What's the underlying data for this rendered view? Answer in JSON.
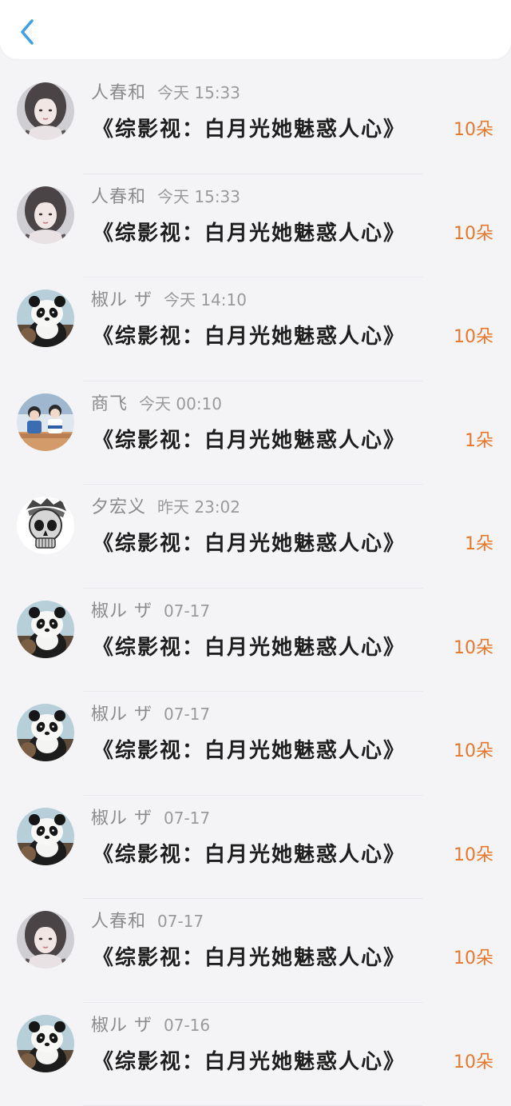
{
  "header": {
    "back_icon": "chevron-left-icon",
    "accent_color": "#3aa0e8"
  },
  "list": {
    "items": [
      {
        "name": "人春和",
        "time": "今天 15:33",
        "title": "《综影视：白月光她魅惑人心》",
        "amount": "10朵",
        "avatar": "portrait"
      },
      {
        "name": "人春和",
        "time": "今天 15:33",
        "title": "《综影视：白月光她魅惑人心》",
        "amount": "10朵",
        "avatar": "portrait"
      },
      {
        "name": "椒ル ザ",
        "time": "今天 14:10",
        "title": "《综影视：白月光她魅惑人心》",
        "amount": "10朵",
        "avatar": "panda"
      },
      {
        "name": "商飞",
        "time": "今天 00:10",
        "title": "《综影视：白月光她魅惑人心》",
        "amount": "1朵",
        "avatar": "group-photo"
      },
      {
        "name": "夕宏义",
        "time": "昨天 23:02",
        "title": "《综影视：白月光她魅惑人心》",
        "amount": "1朵",
        "avatar": "skull"
      },
      {
        "name": "椒ル ザ",
        "time": "07-17",
        "title": "《综影视：白月光她魅惑人心》",
        "amount": "10朵",
        "avatar": "panda"
      },
      {
        "name": "椒ル ザ",
        "time": "07-17",
        "title": "《综影视：白月光她魅惑人心》",
        "amount": "10朵",
        "avatar": "panda"
      },
      {
        "name": "椒ル ザ",
        "time": "07-17",
        "title": "《综影视：白月光她魅惑人心》",
        "amount": "10朵",
        "avatar": "panda"
      },
      {
        "name": "人春和",
        "time": "07-17",
        "title": "《综影视：白月光她魅惑人心》",
        "amount": "10朵",
        "avatar": "portrait"
      },
      {
        "name": "椒ル ザ",
        "time": "07-16",
        "title": "《综影视：白月光她魅惑人心》",
        "amount": "10朵",
        "avatar": "panda"
      }
    ]
  },
  "colors": {
    "amount": "#e8772c",
    "name": "#8b8b8b",
    "title": "#1e1e1e",
    "background": "#f4f4f6"
  }
}
